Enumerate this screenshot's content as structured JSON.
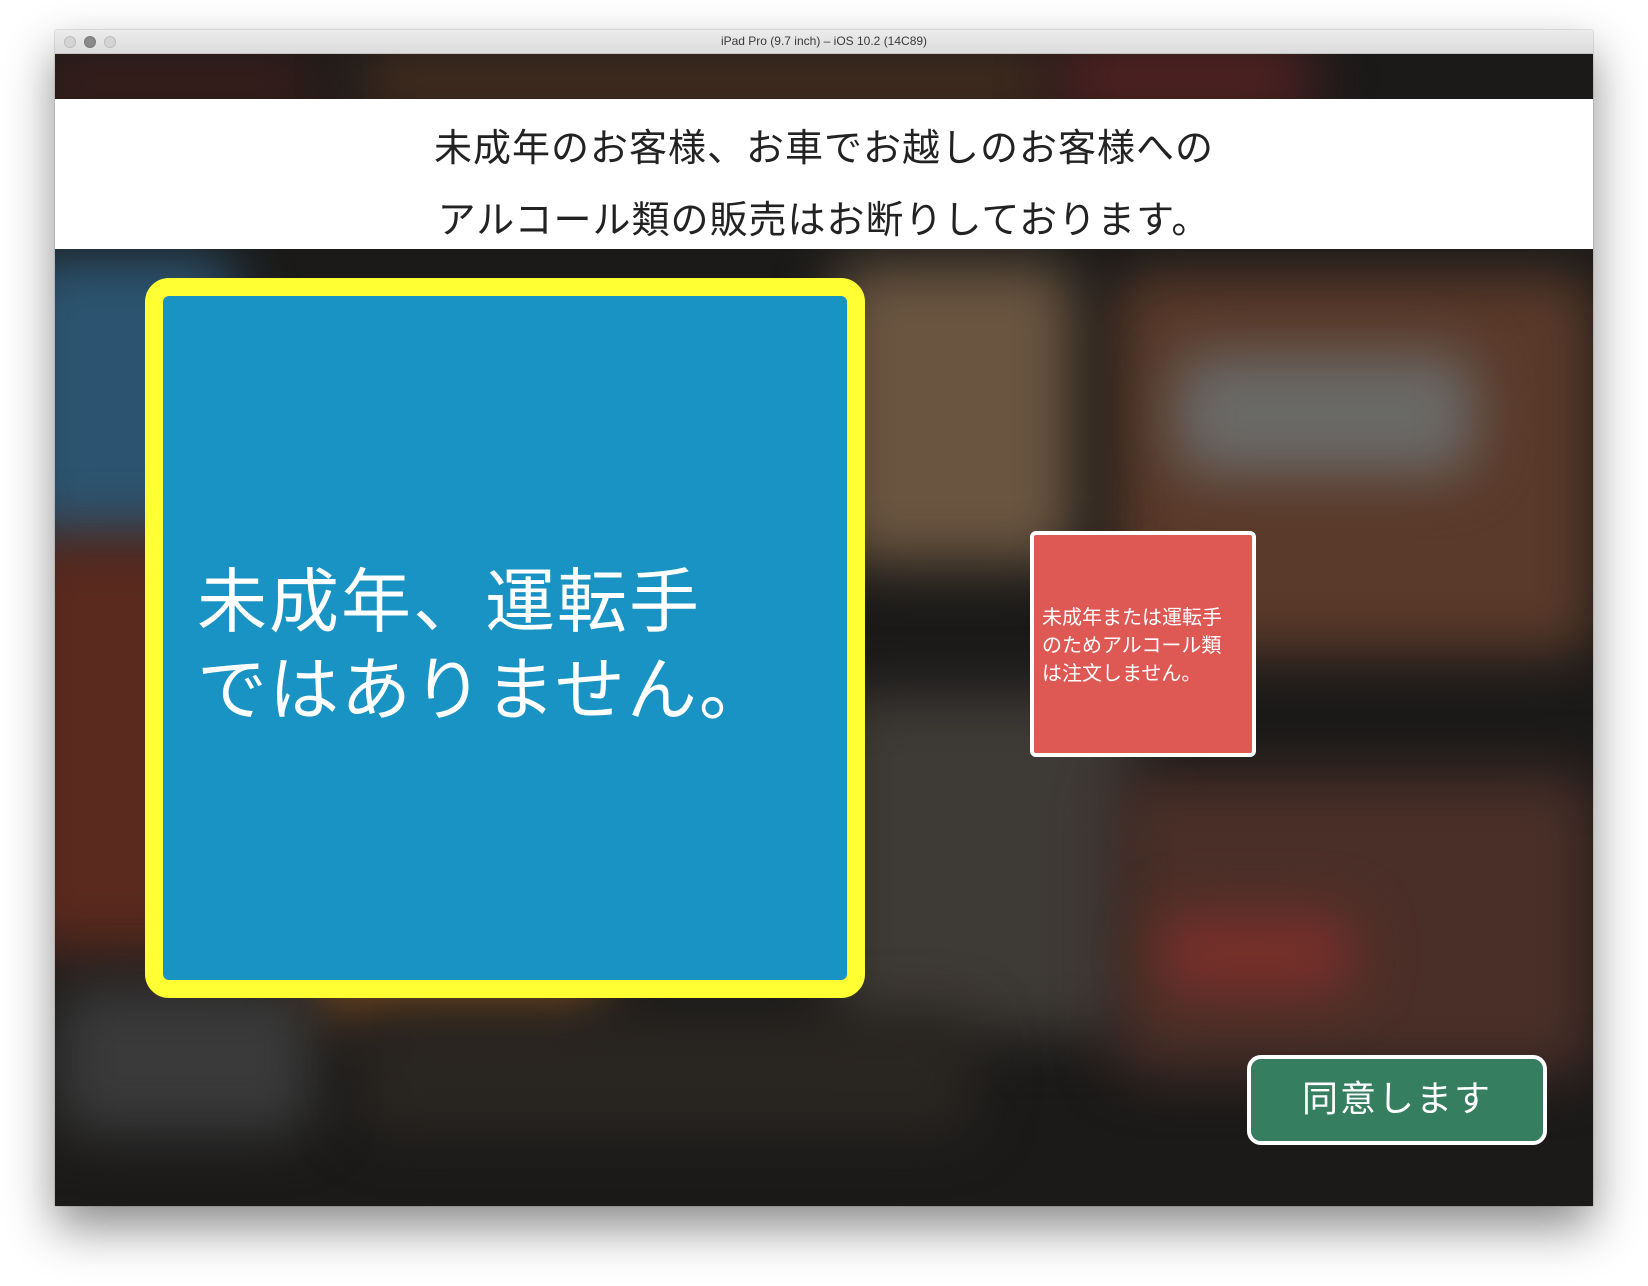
{
  "window": {
    "title": "iPad Pro (9.7 inch) – iOS 10.2 (14C89)"
  },
  "notice": {
    "line1": "未成年のお客様、お車でお越しのお客様への",
    "line2": "アルコール類の販売はお断りしております。"
  },
  "options": {
    "primary": {
      "line1": "未成年、運転手",
      "line2": "ではありません。"
    },
    "secondary": {
      "line1": "未成年または運転手",
      "line2": "のためアルコール類",
      "line3": "は注文しません。"
    }
  },
  "agree_button": {
    "label": "同意します"
  },
  "colors": {
    "highlight_border": "#ffff33",
    "primary_card": "#1893c3",
    "secondary_card": "#de5854",
    "agree_button": "#367e60"
  }
}
